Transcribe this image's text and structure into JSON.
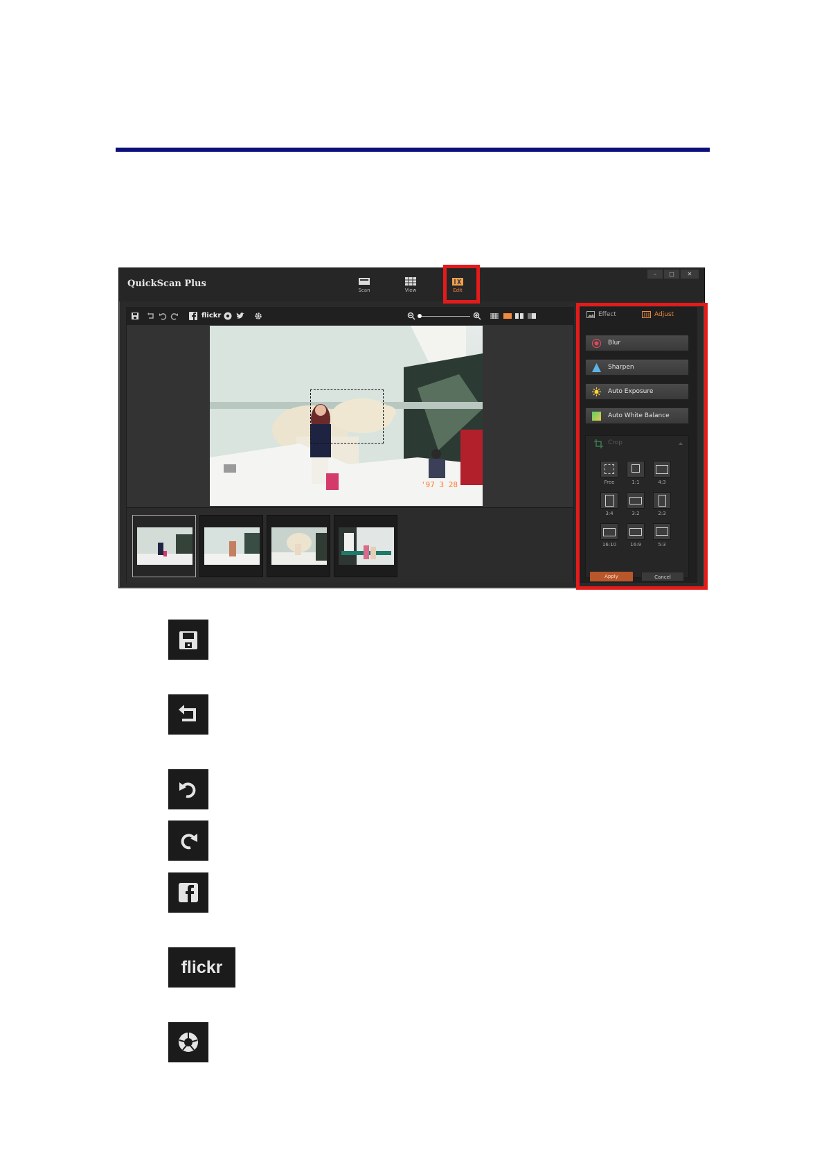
{
  "app": {
    "title": "QuickScan Plus",
    "modes": [
      {
        "label": "Scan"
      },
      {
        "label": "View"
      },
      {
        "label": "Edit"
      }
    ],
    "window_controls": [
      "–",
      "□",
      "✕"
    ]
  },
  "toolbar": {
    "flickr_label": "flickr"
  },
  "photo": {
    "date_stamp": "'97  3  28"
  },
  "panel": {
    "tabs": [
      {
        "label": "Effect"
      },
      {
        "label": "Adjust"
      }
    ],
    "buttons": [
      {
        "label": "Blur"
      },
      {
        "label": "Sharpen"
      },
      {
        "label": "Auto Exposure"
      },
      {
        "label": "Auto White Balance"
      }
    ],
    "crop": {
      "title": "Crop",
      "ratios": [
        "Free",
        "1:1",
        "4:3",
        "3:4",
        "3:2",
        "2:3",
        "16:10",
        "16:9",
        "5:3"
      ],
      "apply_label": "Apply",
      "cancel_label": "Cancel"
    }
  },
  "legend_icons": {
    "flickr_label": "flickr"
  },
  "colors": {
    "rule": "#0a0f7a",
    "highlight": "#e31b1b",
    "accent": "#f08a3c"
  }
}
